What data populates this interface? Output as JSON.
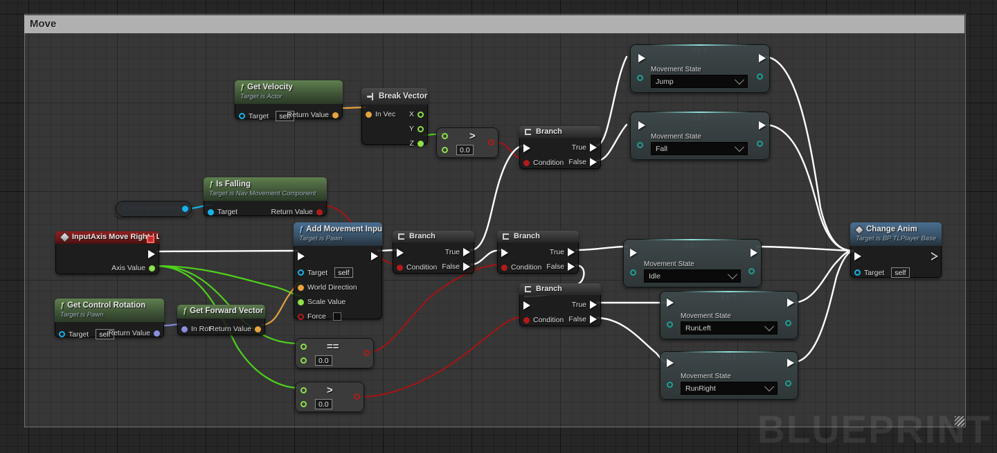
{
  "comment": {
    "title": "Move"
  },
  "watermark": "BLUEPRINT",
  "nodes": {
    "get_velocity": {
      "title": "Get Velocity",
      "subtitle": "Target is Actor",
      "target_label": "Target",
      "target_value": "self",
      "return_label": "Return Value",
      "icon": "function-f-icon"
    },
    "break_vector": {
      "title": "Break Vector",
      "in_label": "In Vec",
      "x_label": "X",
      "y_label": "Y",
      "z_label": "Z",
      "icon": "break-struct-icon"
    },
    "greater_top": {
      "symbol": ">",
      "value": "0.0"
    },
    "branch_top": {
      "title": "Branch",
      "condition_label": "Condition",
      "true_label": "True",
      "false_label": "False",
      "icon": "branch-icon"
    },
    "set_jump": {
      "title": "SET",
      "field_label": "Movement State",
      "value": "Jump"
    },
    "set_fall": {
      "title": "SET",
      "field_label": "Movement State",
      "value": "Fall"
    },
    "is_falling": {
      "title": "Is Falling",
      "subtitle": "Target is Nav Movement Component",
      "target_label": "Target",
      "return_label": "Return Value",
      "icon": "function-f-icon"
    },
    "character_movement": {
      "label": "Character Movement"
    },
    "input_axis": {
      "title": "InputAxis Move Right / Left",
      "axis_label": "Axis Value",
      "icon": "event-diamond-icon"
    },
    "add_movement_input": {
      "title": "Add Movement Input",
      "subtitle": "Target is Pawn",
      "target_label": "Target",
      "target_value": "self",
      "world_direction_label": "World Direction",
      "scale_value_label": "Scale Value",
      "force_label": "Force",
      "icon": "function-f-icon"
    },
    "branch_a": {
      "title": "Branch",
      "condition_label": "Condition",
      "true_label": "True",
      "false_label": "False",
      "icon": "branch-icon"
    },
    "branch_b": {
      "title": "Branch",
      "condition_label": "Condition",
      "true_label": "True",
      "false_label": "False",
      "icon": "branch-icon"
    },
    "branch_c": {
      "title": "Branch",
      "condition_label": "Condition",
      "true_label": "True",
      "false_label": "False",
      "icon": "branch-icon"
    },
    "set_idle": {
      "title": "SET",
      "field_label": "Movement State",
      "value": "Idle"
    },
    "set_runleft": {
      "title": "SET",
      "field_label": "Movement State",
      "value": "RunLeft"
    },
    "set_runright": {
      "title": "SET",
      "field_label": "Movement State",
      "value": "RunRight"
    },
    "change_anim": {
      "title": "Change Anim",
      "subtitle": "Target is BP TLPlayer Base",
      "target_label": "Target",
      "target_value": "self",
      "icon": "event-diamond-icon"
    },
    "get_control_rotation": {
      "title": "Get Control Rotation",
      "subtitle": "Target is Pawn",
      "target_label": "Target",
      "target_value": "self",
      "return_label": "Return Value",
      "icon": "function-f-icon"
    },
    "get_forward_vector": {
      "title": "Get Forward Vector",
      "in_rot_label": "In Rot",
      "return_label": "Return Value",
      "icon": "function-f-icon"
    },
    "equals_node": {
      "symbol": "==",
      "value": "0.0"
    },
    "greater_node": {
      "symbol": ">",
      "value": "0.0"
    }
  },
  "colors": {
    "exec_wire": "#ffffff",
    "bool_wire": "#a01515",
    "float_wire": "#4fd21a",
    "vector_wire": "#e8a33d",
    "object_wire": "#16b3ea",
    "rotator_wire": "#8a8fe0",
    "canvas_bg": "#262626",
    "comment_bar": "#b0b0b0",
    "set_accent": "#7fd6cf",
    "event_header": "#8d2020"
  }
}
